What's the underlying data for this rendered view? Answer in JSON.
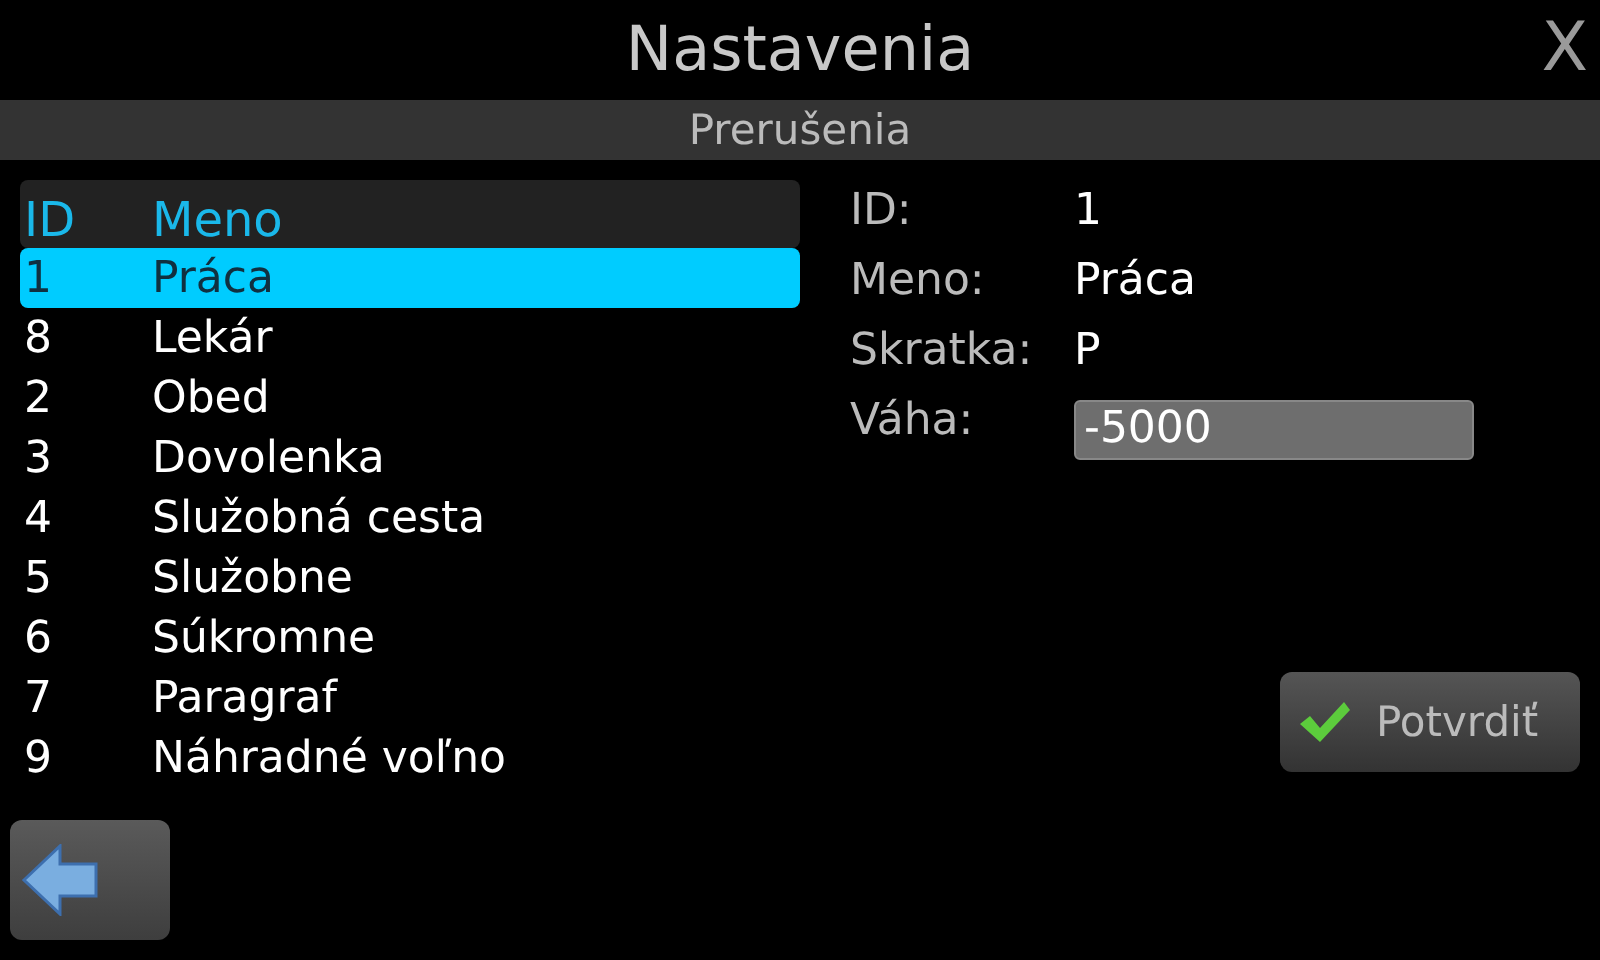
{
  "window": {
    "title": "Nastavenia",
    "close": "X"
  },
  "section": "Prerušenia",
  "list": {
    "columns": [
      "ID",
      "Meno"
    ],
    "rows": [
      {
        "id": "1",
        "name": "Práca",
        "selected": true
      },
      {
        "id": "8",
        "name": "Lekár",
        "selected": false
      },
      {
        "id": "2",
        "name": "Obed",
        "selected": false
      },
      {
        "id": "3",
        "name": "Dovolenka",
        "selected": false
      },
      {
        "id": "4",
        "name": "Služobná cesta",
        "selected": false
      },
      {
        "id": "5",
        "name": "Služobne",
        "selected": false
      },
      {
        "id": "6",
        "name": "Súkromne",
        "selected": false
      },
      {
        "id": "7",
        "name": "Paragraf",
        "selected": false
      },
      {
        "id": "9",
        "name": "Náhradné voľno",
        "selected": false
      }
    ]
  },
  "details": [
    {
      "label": "ID:",
      "value": "1",
      "kind": "text"
    },
    {
      "label": "Meno:",
      "value": "Práca",
      "kind": "text"
    },
    {
      "label": "Skratka:",
      "value": "P",
      "kind": "text"
    },
    {
      "label": "Váha:",
      "value": "-5000",
      "kind": "input"
    }
  ],
  "confirm_button": "Potvrdiť"
}
